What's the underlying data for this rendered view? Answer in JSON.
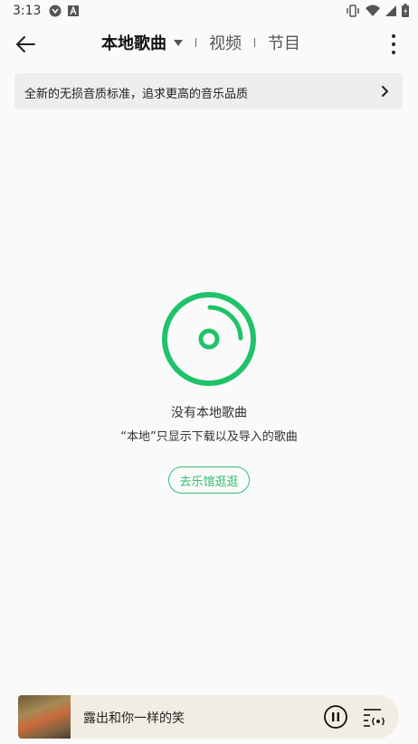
{
  "status_bar": {
    "time": "3:13",
    "left_icons": [
      "app-icon",
      "text-app-icon"
    ],
    "right_icons": [
      "vibrate-icon",
      "wifi-icon",
      "signal-icon",
      "battery-icon"
    ]
  },
  "header": {
    "tabs": [
      {
        "label": "本地歌曲",
        "active": true
      },
      {
        "label": "视频",
        "active": false
      },
      {
        "label": "节目",
        "active": false
      }
    ]
  },
  "banner": {
    "text": "全新的无损音质标准，追求更高的音乐品质"
  },
  "empty_state": {
    "title": "没有本地歌曲",
    "subtitle": "“本地”只显示下载以及导入的歌曲",
    "button_label": "去乐馆逛逛",
    "accent_color": "#2fbf6f"
  },
  "player": {
    "song_title": "露出和你一样的笑",
    "state": "playing"
  }
}
